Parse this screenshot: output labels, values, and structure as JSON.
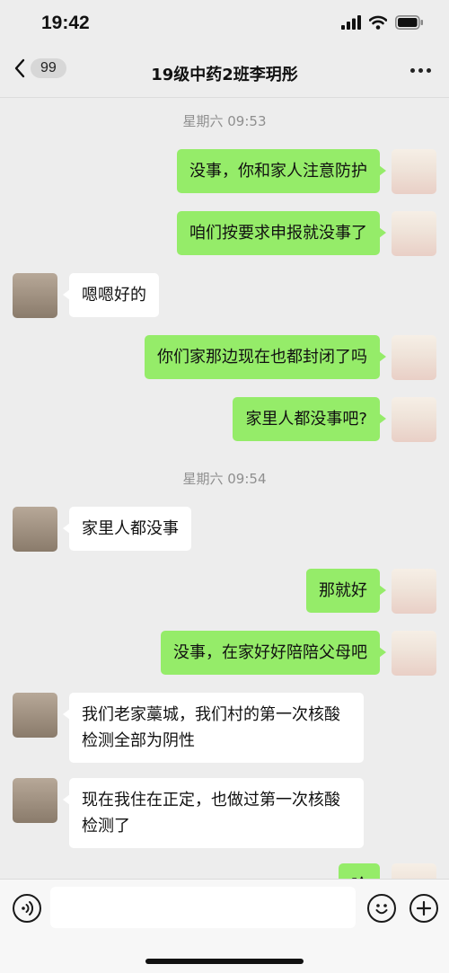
{
  "status": {
    "time": "19:42"
  },
  "nav": {
    "back_count": "99",
    "title": "19级中药2班李玥彤"
  },
  "messages": {
    "sep1": "星期六 09:53",
    "m1": "没事，你和家人注意防护",
    "m2": "咱们按要求申报就没事了",
    "m3": "嗯嗯好的",
    "m4": "你们家那边现在也都封闭了吗",
    "m5": "家里人都没事吧?",
    "sep2": "星期六 09:54",
    "m6": "家里人都没事",
    "m7": "那就好",
    "m8": "没事，在家好好陪陪父母吧",
    "m9": "我们老家藁城，我们村的第一次核酸检测全部为阴性",
    "m10": "现在我住在正定，也做过第一次核酸检测了",
    "m11": "哈"
  },
  "input": {
    "value": ""
  },
  "colors": {
    "outgoing_bubble": "#95ec69",
    "incoming_bubble": "#ffffff",
    "background": "#ededed"
  },
  "icons": {
    "voice": "voice-icon",
    "emoji": "emoji-icon",
    "plus": "plus-icon",
    "back": "chevron-left-icon",
    "more": "more-icon"
  }
}
